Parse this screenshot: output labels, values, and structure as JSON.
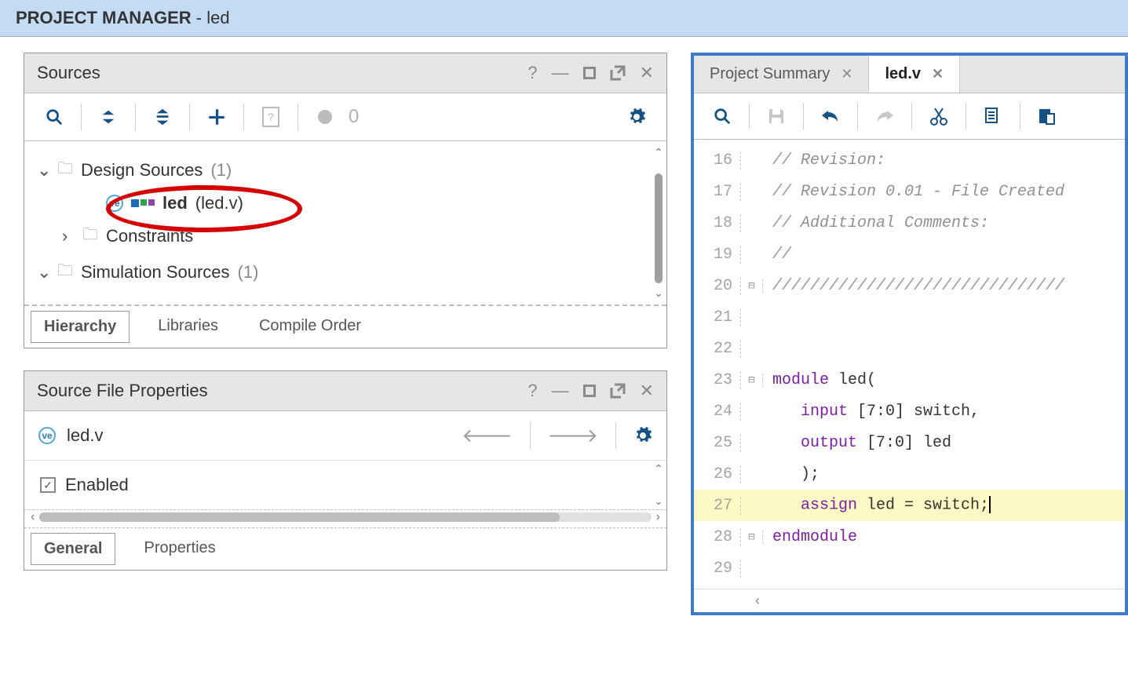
{
  "header": {
    "title_prefix": "PROJECT MANAGER",
    "title_suffix": " - led"
  },
  "sources": {
    "title": "Sources",
    "toolbar_count": "0",
    "tree": {
      "design": {
        "label": "Design Sources",
        "count": "(1)"
      },
      "file": {
        "name": "led",
        "paren": "(led.v)"
      },
      "constraints": {
        "label": "Constraints"
      },
      "sim": {
        "label": "Simulation Sources",
        "count": "(1)"
      }
    },
    "tabs": {
      "hierarchy": "Hierarchy",
      "libraries": "Libraries",
      "compile": "Compile Order"
    }
  },
  "props": {
    "title": "Source File Properties",
    "file": "led.v",
    "enabled_label": "Enabled",
    "tabs": {
      "general": "General",
      "properties": "Properties"
    }
  },
  "editor": {
    "tabs": {
      "summary": "Project Summary",
      "file": "led.v"
    },
    "lines": [
      {
        "n": "16",
        "cls": "cm",
        "t": "// Revision:"
      },
      {
        "n": "17",
        "cls": "cm",
        "t": "// Revision 0.01 - File Created"
      },
      {
        "n": "18",
        "cls": "cm",
        "t": "// Additional Comments:"
      },
      {
        "n": "19",
        "cls": "cm",
        "t": "//"
      },
      {
        "n": "20",
        "cls": "cm",
        "t": "///////////////////////////////",
        "fold": "⊟"
      },
      {
        "n": "21",
        "t": ""
      },
      {
        "n": "22",
        "t": ""
      },
      {
        "n": "23",
        "fold": "⊟"
      },
      {
        "n": "24"
      },
      {
        "n": "25"
      },
      {
        "n": "26"
      },
      {
        "n": "27",
        "hl": true
      },
      {
        "n": "28",
        "fold": "⊟"
      },
      {
        "n": "29",
        "t": ""
      }
    ],
    "l23": {
      "kw": "module",
      "id": " led("
    },
    "l24": {
      "kw": "input",
      "rest": " [7:0] switch,"
    },
    "l25": {
      "kw": "output",
      "rest": " [7:0] led"
    },
    "l26": {
      "t": ");"
    },
    "l27": {
      "kw": "assign",
      "rest": " led = switch;"
    },
    "l28": {
      "kw": "endmodule"
    }
  }
}
